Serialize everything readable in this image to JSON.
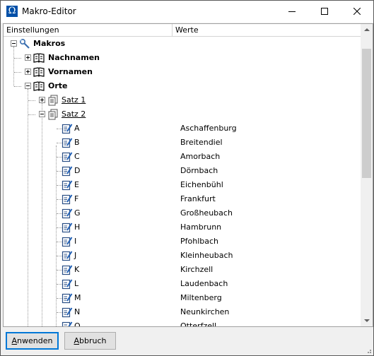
{
  "window": {
    "title": "Makro-Editor",
    "icon_glyph": "Ω"
  },
  "header": {
    "col1": "Einstellungen",
    "col2": "Werte"
  },
  "tree": {
    "root": "Makros",
    "groups": [
      "Nachnamen",
      "Vornamen",
      "Orte"
    ],
    "sets": [
      "Satz 1",
      "Satz 2"
    ],
    "entries": [
      {
        "key": "A",
        "value": "Aschaffenburg"
      },
      {
        "key": "B",
        "value": "Breitendiel"
      },
      {
        "key": "C",
        "value": "Amorbach"
      },
      {
        "key": "D",
        "value": "Dörnbach"
      },
      {
        "key": "E",
        "value": "Eichenbühl"
      },
      {
        "key": "F",
        "value": "Frankfurt"
      },
      {
        "key": "G",
        "value": "Großheubach"
      },
      {
        "key": "H",
        "value": "Hambrunn"
      },
      {
        "key": "I",
        "value": "Pfohlbach"
      },
      {
        "key": "J",
        "value": "Kleinheubach"
      },
      {
        "key": "K",
        "value": "Kirchzell"
      },
      {
        "key": "L",
        "value": "Laudenbach"
      },
      {
        "key": "M",
        "value": "Miltenberg"
      },
      {
        "key": "N",
        "value": "Neunkirchen"
      },
      {
        "key": "O",
        "value": "Otterfzell"
      }
    ]
  },
  "buttons": {
    "apply_first": "A",
    "apply_rest": "nwenden",
    "cancel_first": "A",
    "cancel_rest": "bbruch"
  },
  "colors": {
    "accent": "#0078d7",
    "app_icon": "#0050a8"
  }
}
